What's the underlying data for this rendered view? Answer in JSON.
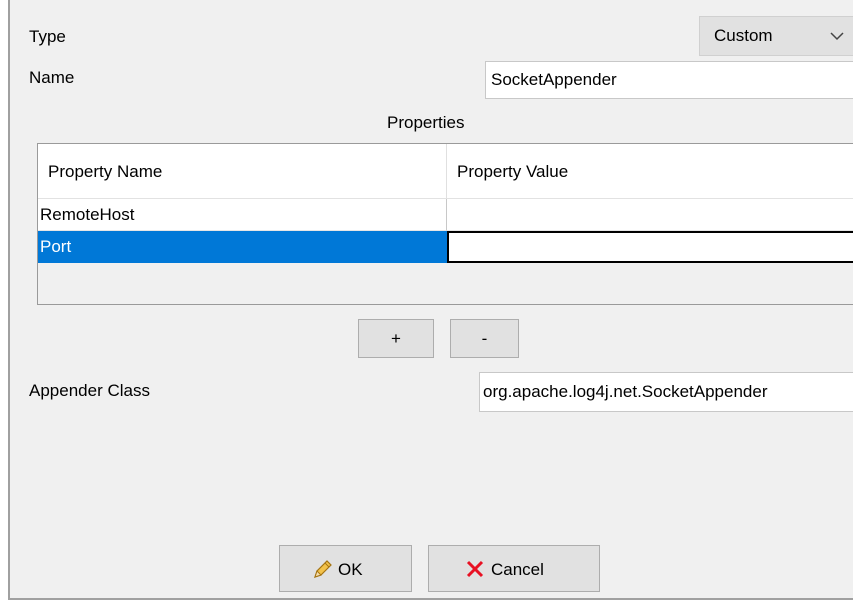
{
  "form": {
    "type_label": "Type",
    "type_value": "Custom",
    "name_label": "Name",
    "name_value": "SocketAppender",
    "properties_title": "Properties",
    "appender_class_label": "Appender Class",
    "appender_class_value": "org.apache.log4j.net.SocketAppender"
  },
  "table": {
    "headers": [
      "Property Name",
      "Property Value"
    ],
    "rows": [
      {
        "name": "RemoteHost",
        "value": ""
      },
      {
        "name": "Port",
        "value": ""
      }
    ],
    "selected_row": 1
  },
  "buttons": {
    "add": "+",
    "remove": "-",
    "ok": "OK",
    "cancel": "Cancel"
  },
  "colors": {
    "selection": "#0078d7",
    "cancel_icon": "#e81123",
    "ok_icon": "#e8a21a"
  }
}
